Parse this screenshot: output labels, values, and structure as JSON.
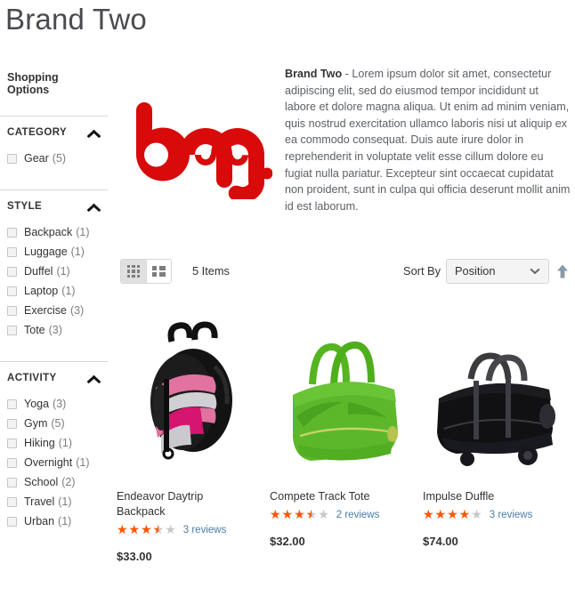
{
  "page": {
    "title": "Brand Two"
  },
  "sidebar": {
    "heading": "Shopping Options",
    "filters": [
      {
        "name": "CATEGORY",
        "options": [
          {
            "label": "Gear",
            "count": "(5)"
          }
        ]
      },
      {
        "name": "STYLE",
        "options": [
          {
            "label": "Backpack",
            "count": "(1)"
          },
          {
            "label": "Luggage",
            "count": "(1)"
          },
          {
            "label": "Duffel",
            "count": "(1)"
          },
          {
            "label": "Laptop",
            "count": "(1)"
          },
          {
            "label": "Exercise",
            "count": "(3)"
          },
          {
            "label": "Tote",
            "count": "(3)"
          }
        ]
      },
      {
        "name": "ACTIVITY",
        "options": [
          {
            "label": "Yoga",
            "count": "(3)"
          },
          {
            "label": "Gym",
            "count": "(5)"
          },
          {
            "label": "Hiking",
            "count": "(1)"
          },
          {
            "label": "Overnight",
            "count": "(1)"
          },
          {
            "label": "School",
            "count": "(2)"
          },
          {
            "label": "Travel",
            "count": "(1)"
          },
          {
            "label": "Urban",
            "count": "(1)"
          }
        ]
      }
    ]
  },
  "brand": {
    "logo_text": "bag.",
    "logo_color": "#d80a0a",
    "description_lead": "Brand Two",
    "description_body": " - Lorem ipsum dolor sit amet, consectetur adipiscing elit, sed do eiusmod tempor incididunt ut labore et dolore magna aliqua. Ut enim ad minim veniam, quis nostrud exercitation ullamco laboris nisi ut aliquip ex ea commodo consequat. Duis aute irure dolor in reprehenderit in voluptate velit esse cillum dolore eu fugiat nulla pariatur. Excepteur sint occaecat cupidatat non proident, sunt in culpa qui officia deserunt mollit anim id est laborum."
  },
  "toolbar": {
    "grid_mode": "grid-view",
    "list_mode": "list-view",
    "active_mode": "grid-view",
    "items_count": "5 Items",
    "sort_by_label": "Sort By",
    "sort_value": "Position",
    "sort_direction": "ascending"
  },
  "products": [
    {
      "name": "Endeavor Daytrip Backpack",
      "rating_percent": 70,
      "reviews": "3 reviews",
      "price": "$33.00",
      "image": "pink-black-backpack"
    },
    {
      "name": "Compete Track Tote",
      "rating_percent": 70,
      "reviews": "2 reviews",
      "price": "$32.00",
      "image": "green-tote-bag"
    },
    {
      "name": "Impulse Duffle",
      "rating_percent": 80,
      "reviews": "3 reviews",
      "price": "$74.00",
      "image": "black-rolling-duffle"
    }
  ],
  "colors": {
    "star_filled": "#ff5501",
    "star_empty": "#c7c7c7",
    "link": "#4a7ca8",
    "text": "#333333"
  }
}
